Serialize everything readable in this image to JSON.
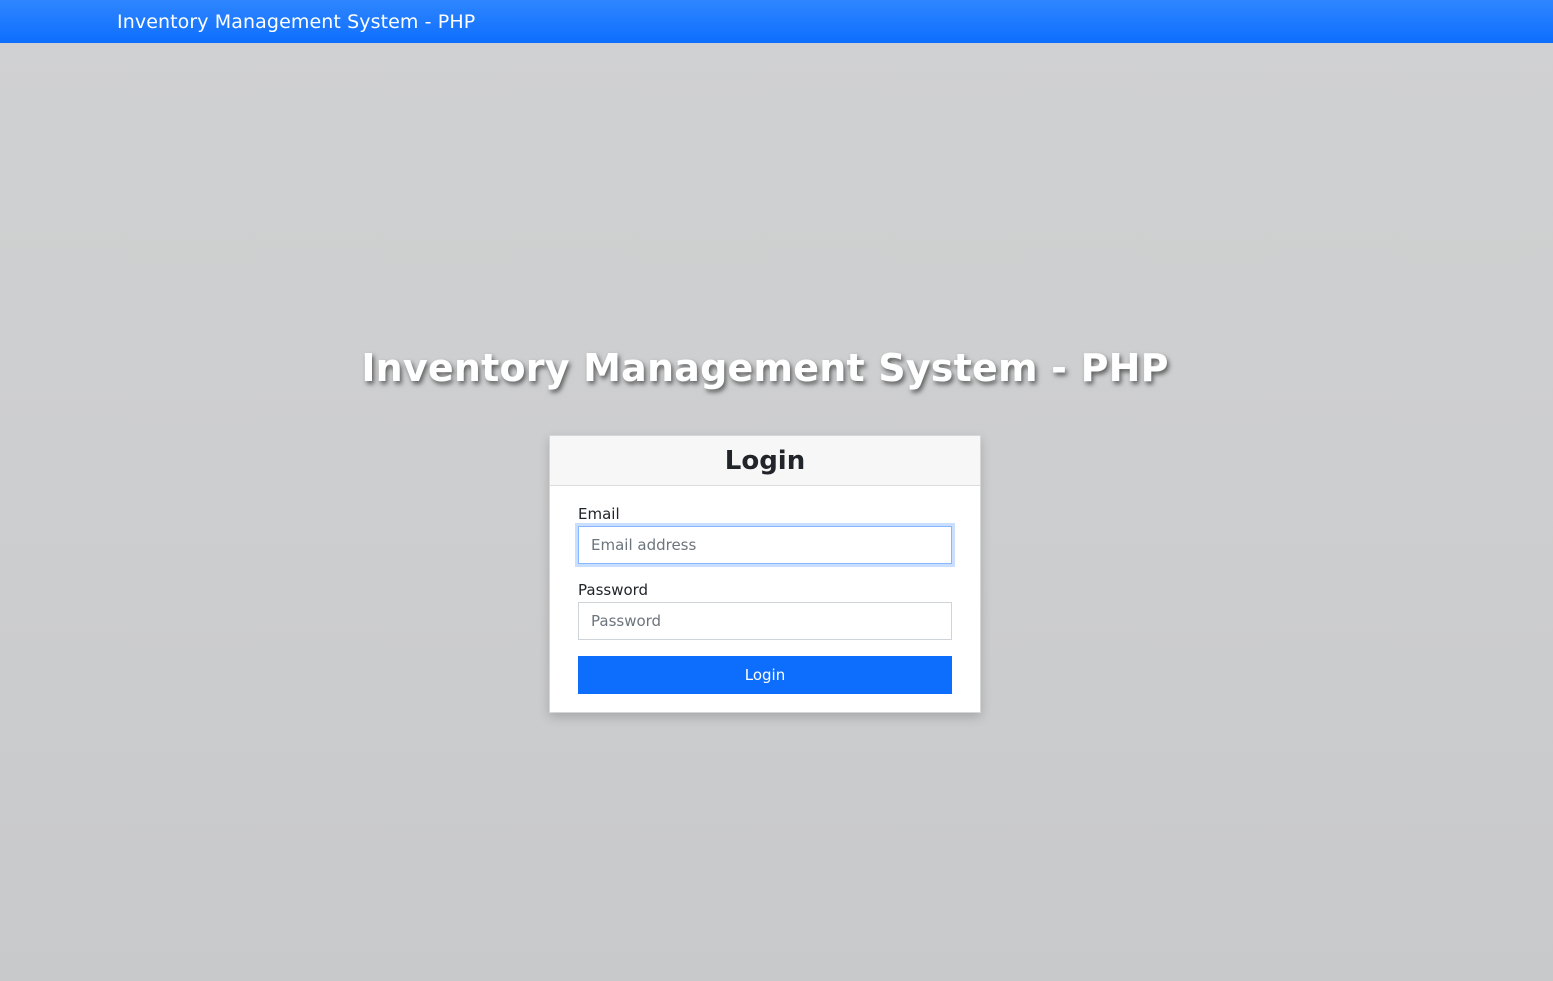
{
  "navbar": {
    "brand": "Inventory Management System - PHP",
    "color": "#0d6efd"
  },
  "hero": {
    "title": "Inventory Management System - PHP"
  },
  "login": {
    "title": "Login",
    "email_label": "Email",
    "email_placeholder": "Email address",
    "email_value": "",
    "password_label": "Password",
    "password_placeholder": "Password",
    "password_value": "",
    "button_label": "Login",
    "button_color": "#0d6efd"
  }
}
